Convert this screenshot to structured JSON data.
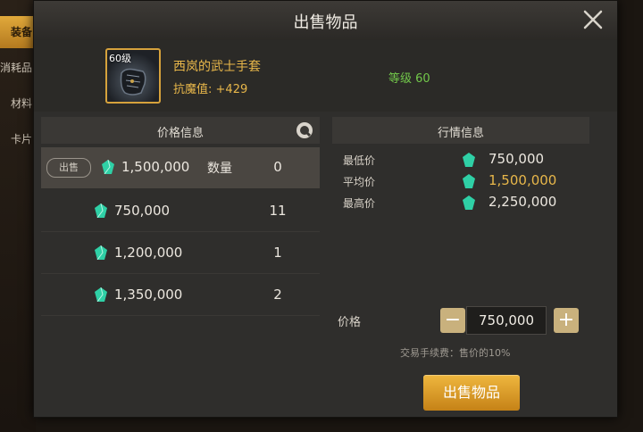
{
  "background_tabs": [
    {
      "label": "装备",
      "active": true
    },
    {
      "label": "消耗品",
      "active": false
    },
    {
      "label": "材料",
      "active": false
    },
    {
      "label": "卡片",
      "active": false
    }
  ],
  "dialog": {
    "title": "出售物品",
    "close_icon": "close-icon"
  },
  "item": {
    "level_badge": "60级",
    "name": "西岚的武士手套",
    "resist_label": "抗魔值:",
    "resist_value": "+429",
    "level_text": "等级 60",
    "icon": "glove-icon"
  },
  "price_info": {
    "header": "价格信息",
    "refresh_icon": "refresh-icon",
    "selected": {
      "tag": "出售",
      "price": "1,500,000",
      "qty_label": "数量",
      "qty": "0"
    },
    "listings": [
      {
        "price": "750,000",
        "qty": "11"
      },
      {
        "price": "1,200,000",
        "qty": "1"
      },
      {
        "price": "1,350,000",
        "qty": "2"
      }
    ]
  },
  "market_info": {
    "header": "行情信息",
    "rows": [
      {
        "label": "最低价",
        "value": "750,000",
        "highlight": false
      },
      {
        "label": "平均价",
        "value": "1,500,000",
        "highlight": true
      },
      {
        "label": "最高价",
        "value": "2,250,000",
        "highlight": false
      }
    ]
  },
  "price_input": {
    "label": "价格",
    "value": "750,000",
    "minus": "−",
    "plus": "+"
  },
  "fee_note": "交易手续费：售价的10%",
  "sell_button": "出售物品",
  "colors": {
    "accent_gold": "#e8b74a",
    "level_green": "#72c84a",
    "gem": "#2fd0a6"
  }
}
